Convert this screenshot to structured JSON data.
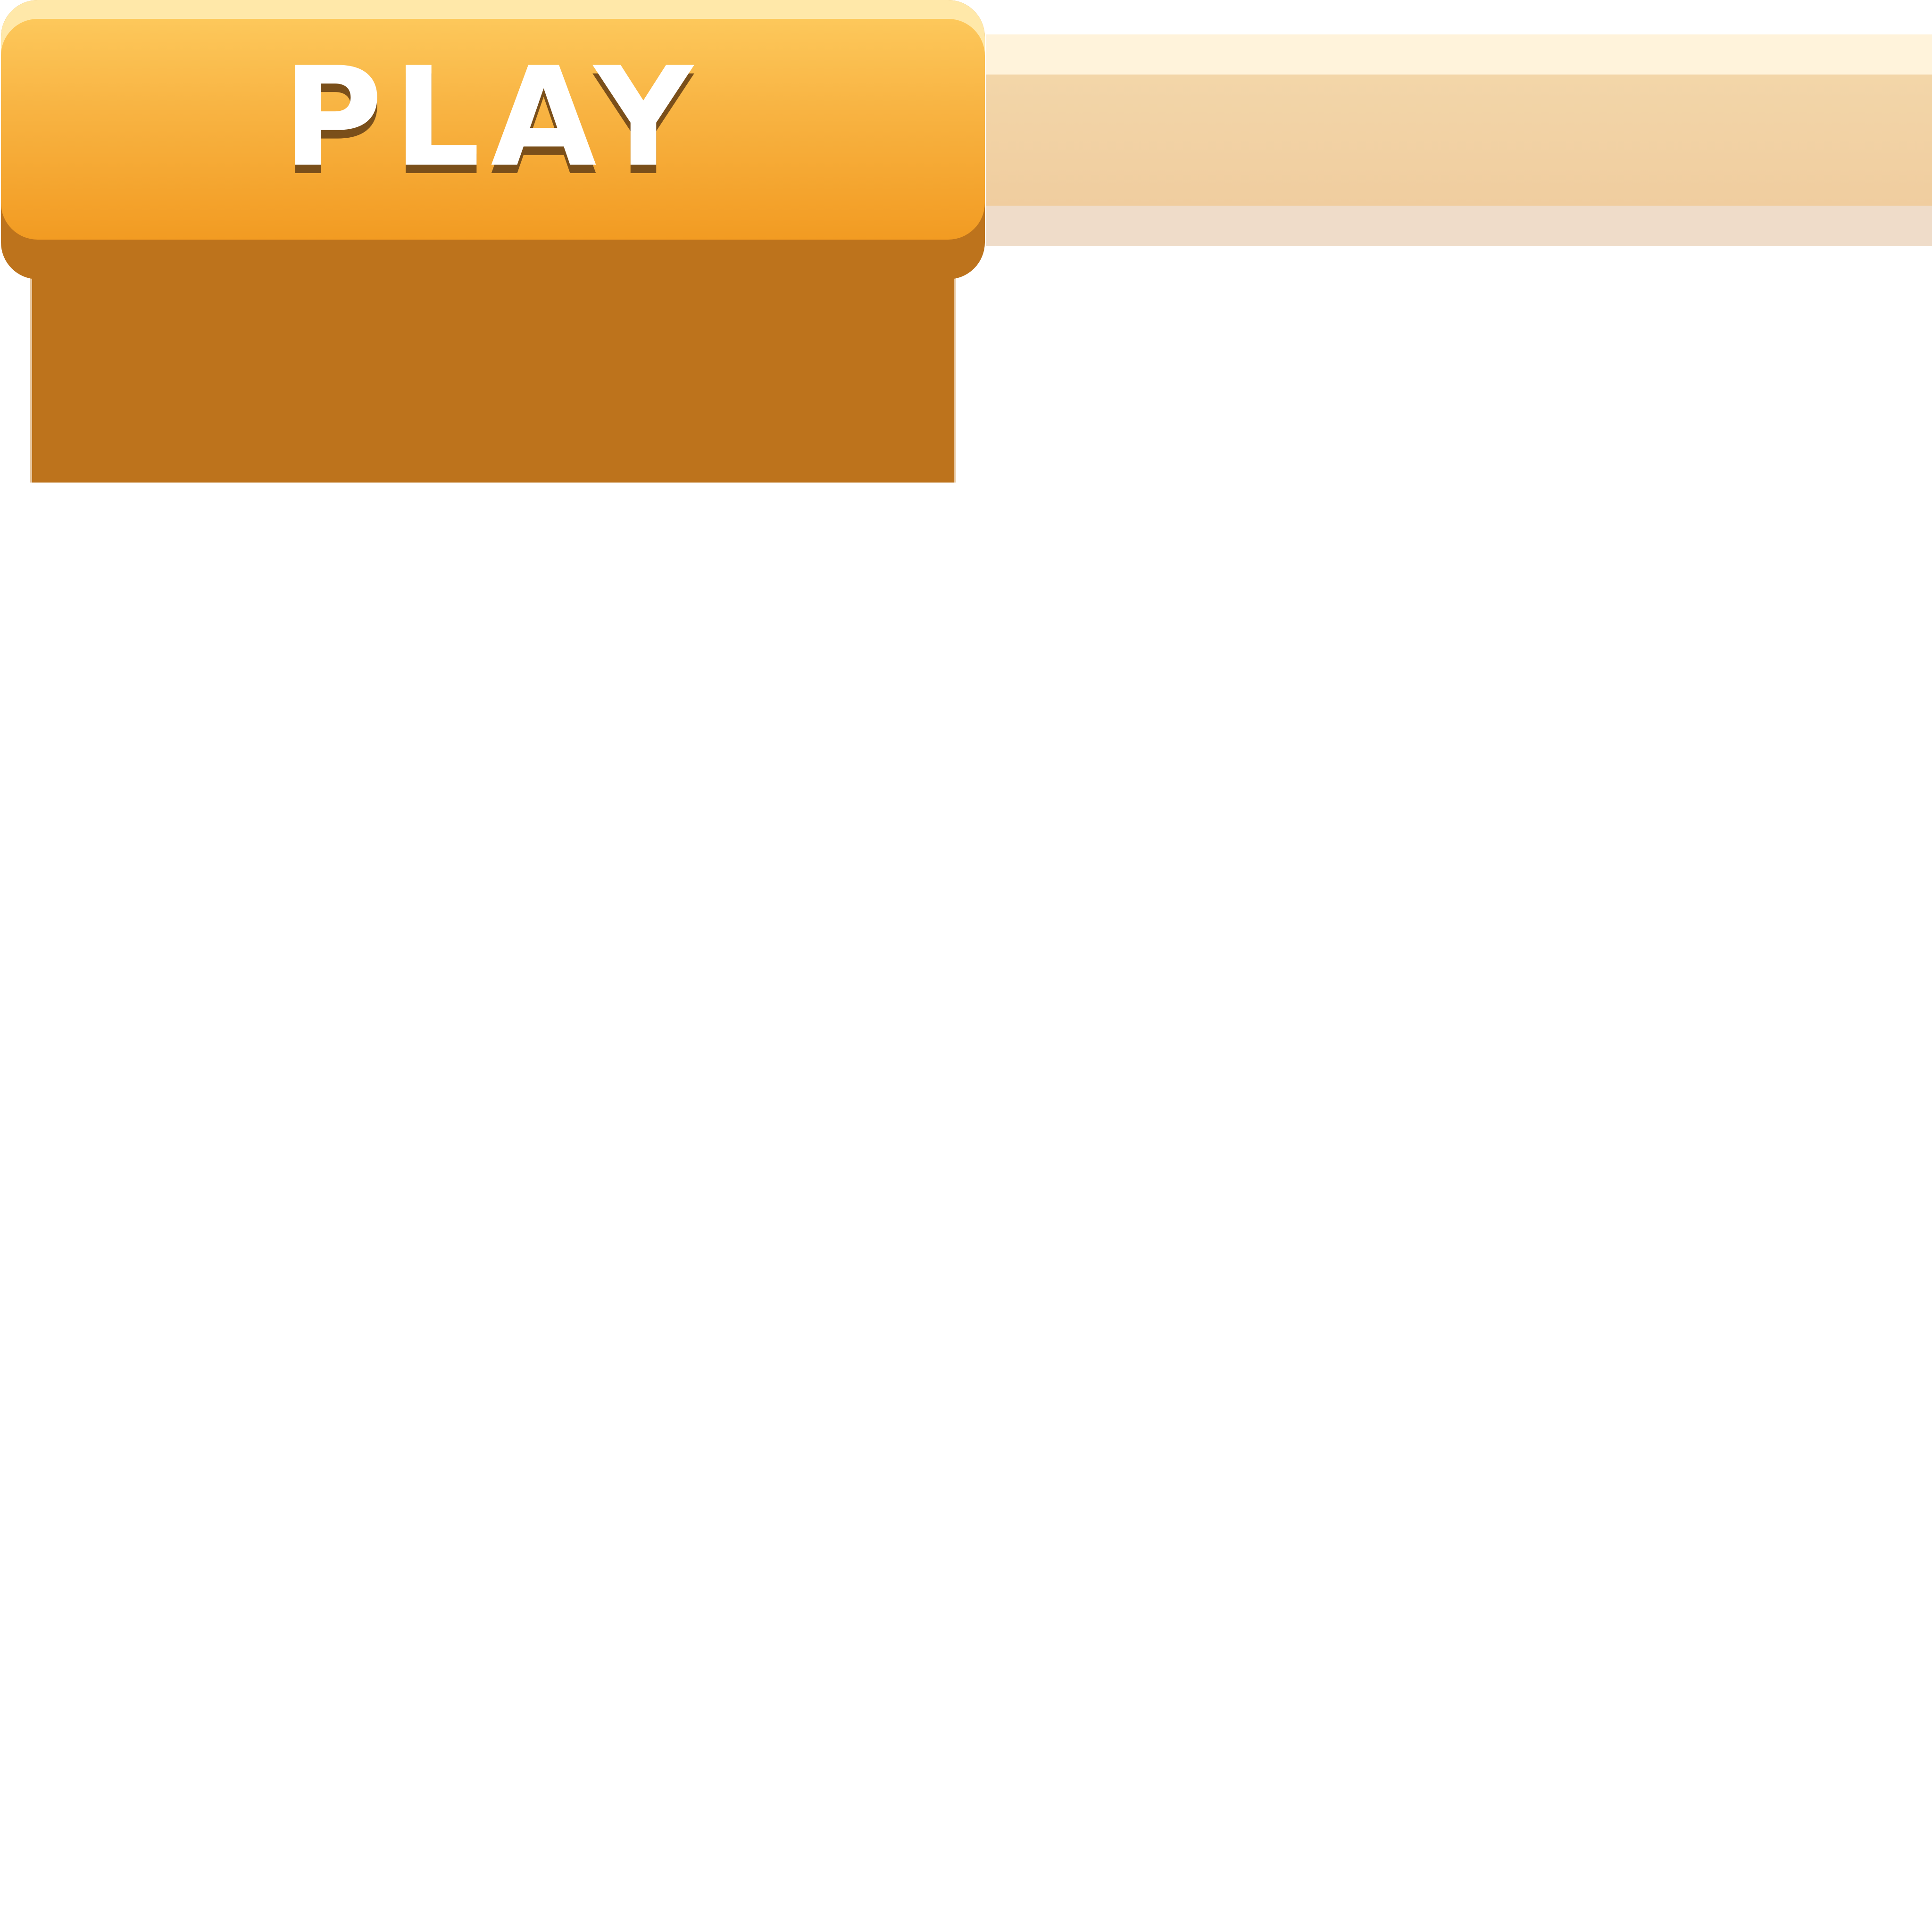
{
  "play_button": {
    "label": "PLAY"
  },
  "colors": {
    "button_face_top": "#fdc85b",
    "button_face_bottom": "#f29b22",
    "button_rim": "#ffe8a9",
    "button_base": "#bd731c",
    "label_text": "#ffffff",
    "label_shadow": "#7a4f1a",
    "bar_top": "#fff3db",
    "bar_mid": "#f0cd9f",
    "bar_bottom": "#efdcc9"
  }
}
